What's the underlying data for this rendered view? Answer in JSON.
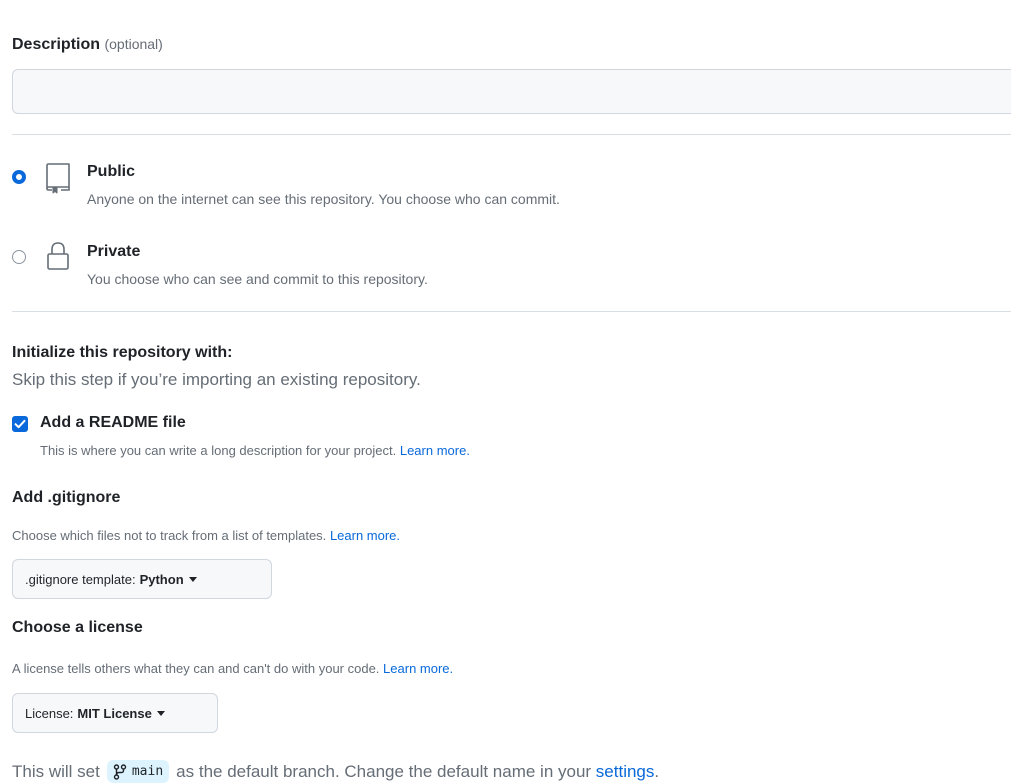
{
  "description": {
    "label": "Description",
    "optional": "(optional)",
    "value": "",
    "placeholder": ""
  },
  "visibility": {
    "public": {
      "title": "Public",
      "desc": "Anyone on the internet can see this repository. You choose who can commit.",
      "checked": true,
      "icon": "repo-icon"
    },
    "private": {
      "title": "Private",
      "desc": "You choose who can see and commit to this repository.",
      "checked": false,
      "icon": "lock-icon"
    }
  },
  "initialize": {
    "title": "Initialize this repository with:",
    "subtitle": "Skip this step if you’re importing an existing repository."
  },
  "readme": {
    "title": "Add a README file",
    "desc": "This is where you can write a long description for your project.",
    "link": "Learn more.",
    "checked": true
  },
  "gitignore": {
    "title": "Add .gitignore",
    "desc": "Choose which files not to track from a list of templates.",
    "link": "Learn more.",
    "button_label": ".gitignore template:",
    "button_value": "Python"
  },
  "license": {
    "title": "Choose a license",
    "desc": "A license tells others what they can and can't do with your code.",
    "link": "Learn more.",
    "button_label": "License:",
    "button_value": "MIT License"
  },
  "footer": {
    "prefix": "This will set",
    "branch": "main",
    "middle": "as the default branch. Change the default name in your",
    "link": "settings",
    "suffix": "."
  },
  "colors": {
    "accent": "#0969da",
    "muted_text": "#656d76",
    "border": "#d0d7de",
    "branch_bg": "#ddf4ff"
  }
}
